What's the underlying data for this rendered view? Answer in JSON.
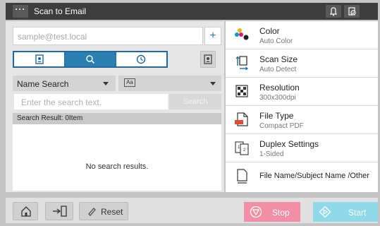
{
  "header": {
    "menu_label": "···",
    "title": "Scan to Email"
  },
  "destination": {
    "placeholder": "sample@test.local",
    "add_label": "+"
  },
  "search": {
    "type_selected": "Name Search",
    "input_placeholder": "Enter the search text.",
    "search_button": "Search",
    "result_header": "Search Result: 0Item",
    "empty_text": "No search results."
  },
  "settings": [
    {
      "label": "Color",
      "value": "Auto Color",
      "icon": "color-icon"
    },
    {
      "label": "Scan Size",
      "value": "Auto Detect",
      "icon": "scan-size-icon"
    },
    {
      "label": "Resolution",
      "value": "300x300dpi",
      "icon": "resolution-icon"
    },
    {
      "label": "File Type",
      "value": "Compact PDF",
      "icon": "pdf-file-icon"
    },
    {
      "label": "Duplex Settings",
      "value": "1-Sided",
      "icon": "duplex-icon"
    },
    {
      "label": "File Name/Subject Name /Other",
      "value": "",
      "icon": "document-icon"
    }
  ],
  "footer": {
    "reset_label": "Reset",
    "stop_label": "Stop",
    "start_label": "Start"
  },
  "colors": {
    "accent": "#2b7fb1",
    "stop": "#f08fa6",
    "start": "#8fd9e8",
    "topbar": "#3d3d3d"
  }
}
